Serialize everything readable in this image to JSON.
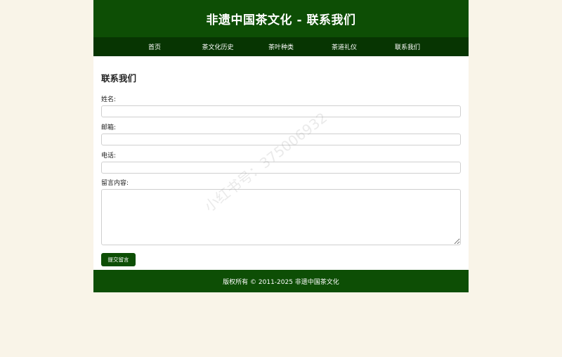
{
  "header": {
    "title": "非遗中国茶文化 - 联系我们"
  },
  "nav": {
    "items": [
      "首页",
      "茶文化历史",
      "茶叶种类",
      "茶道礼仪",
      "联系我们"
    ]
  },
  "main": {
    "heading": "联系我们",
    "fields": {
      "name_label": "姓名:",
      "email_label": "邮箱:",
      "phone_label": "电话:",
      "message_label": "留言内容:"
    },
    "submit_label": "提交留言"
  },
  "footer": {
    "text": "版权所有 © 2011-2025 非遗中国茶文化"
  },
  "watermark": "小红书号：375006932",
  "colors": {
    "primary_green": "#0d4e05",
    "nav_green": "#073502",
    "page_background": "#f9f4e8"
  }
}
